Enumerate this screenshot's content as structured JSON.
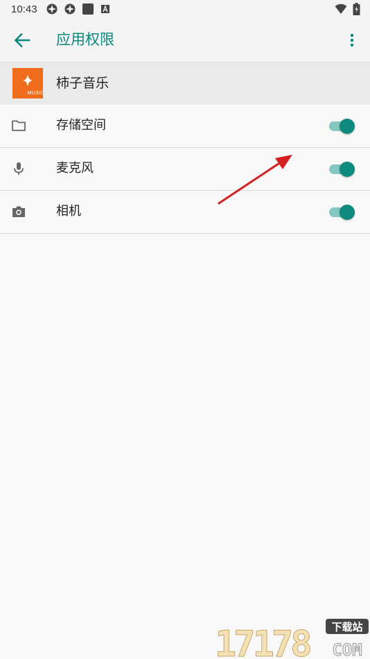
{
  "status_bar": {
    "time": "10:43",
    "left_icons": [
      "sync-icon",
      "sync-icon",
      "square-icon",
      "text-a-icon"
    ],
    "right_icons": [
      "wifi-icon",
      "battery-icon"
    ]
  },
  "app_bar": {
    "title": "应用权限",
    "back_icon": "arrow-left-icon",
    "menu_icon": "more-vert-icon"
  },
  "app": {
    "name": "柿子音乐",
    "logo_text": "MUSIC",
    "logo_color": "#ef6d1c"
  },
  "permissions": [
    {
      "label": "存储空间",
      "icon": "folder-icon",
      "enabled": true
    },
    {
      "label": "麦克风",
      "icon": "microphone-icon",
      "enabled": true
    },
    {
      "label": "相机",
      "icon": "camera-icon",
      "enabled": true
    }
  ],
  "colors": {
    "accent": "#0b877c",
    "toggle_thumb": "#0e8a7f",
    "toggle_track": "#84c7c0",
    "annotation": "#d42020"
  },
  "watermark": {
    "number": "17178",
    "tag": "下载站",
    "domain": "COM"
  }
}
